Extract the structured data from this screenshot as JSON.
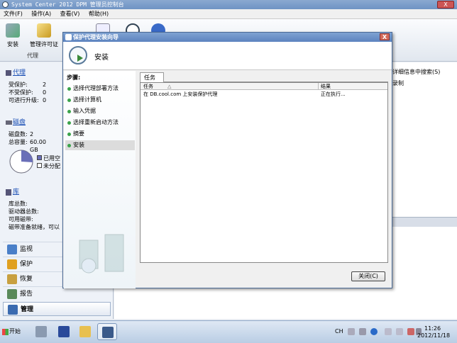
{
  "window": {
    "title": "System Center 2012 DPM 管理员控制台",
    "close_glyph": "X"
  },
  "menu": [
    "文件(F)",
    "操作(A)",
    "查看(V)",
    "帮助(H)"
  ],
  "ribbon": {
    "install_label": "安装",
    "license_label": "管理许可证",
    "group_label": "代理"
  },
  "nav": {
    "agents": {
      "title": "代理",
      "rows": [
        {
          "label": "受保护:",
          "value": "2"
        },
        {
          "label": "不受保护:",
          "value": "0"
        },
        {
          "label": "可进行升级:",
          "value": "0"
        }
      ]
    },
    "disks": {
      "title": "磁盘",
      "rows": [
        {
          "label": "磁盘数:",
          "value": "2"
        },
        {
          "label": "总容量:",
          "value": "60.00 GB"
        }
      ],
      "legend_used": "已用空",
      "legend_free": "未分配",
      "used_fraction": 0.26
    },
    "library": {
      "title": "库",
      "rows": [
        "库总数:",
        "驱动器总数:",
        "可用磁带:",
        "磁带准备就绪，可以"
      ]
    },
    "workspaces": [
      {
        "label": "监视",
        "icon": "monitor-icon",
        "color": "#4a7fc8"
      },
      {
        "label": "保护",
        "icon": "protect-icon",
        "color": "#e0a020"
      },
      {
        "label": "恢复",
        "icon": "recover-icon",
        "color": "#c8a040"
      },
      {
        "label": "报告",
        "icon": "report-icon",
        "color": "#5a8a5a"
      },
      {
        "label": "管理",
        "icon": "manage-icon",
        "color": "#3a6ab0"
      }
    ]
  },
  "right": {
    "search_hint": "详细信息中搜索(S)",
    "col_hint": "录制"
  },
  "dialog": {
    "title": "保护代理安装向导",
    "heading": "安装",
    "steps_title": "步骤:",
    "steps": [
      "选择代理部署方法",
      "选择计算机",
      "输入凭据",
      "选择重新启动方法",
      "摘要",
      "安装"
    ],
    "current_step": 5,
    "tab": "任务",
    "columns": {
      "task": "任务",
      "result": "结果"
    },
    "rows": [
      {
        "task": "在 DB.cool.com 上安装保护代理",
        "result": "正在执行..."
      }
    ],
    "close_button": "关闭(C)"
  },
  "taskbar": {
    "start": "开始",
    "lang": "CH",
    "time": "11:26",
    "date": "2012/11/18"
  }
}
